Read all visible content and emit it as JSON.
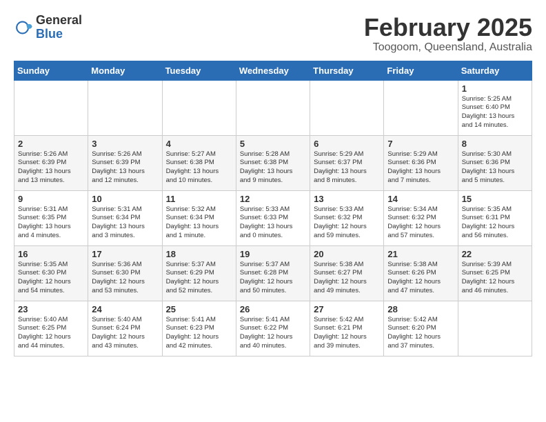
{
  "header": {
    "logo_general": "General",
    "logo_blue": "Blue",
    "month_title": "February 2025",
    "location": "Toogoom, Queensland, Australia"
  },
  "weekdays": [
    "Sunday",
    "Monday",
    "Tuesday",
    "Wednesday",
    "Thursday",
    "Friday",
    "Saturday"
  ],
  "weeks": [
    [
      {
        "day": "",
        "info": ""
      },
      {
        "day": "",
        "info": ""
      },
      {
        "day": "",
        "info": ""
      },
      {
        "day": "",
        "info": ""
      },
      {
        "day": "",
        "info": ""
      },
      {
        "day": "",
        "info": ""
      },
      {
        "day": "1",
        "info": "Sunrise: 5:25 AM\nSunset: 6:40 PM\nDaylight: 13 hours\nand 14 minutes."
      }
    ],
    [
      {
        "day": "2",
        "info": "Sunrise: 5:26 AM\nSunset: 6:39 PM\nDaylight: 13 hours\nand 13 minutes."
      },
      {
        "day": "3",
        "info": "Sunrise: 5:26 AM\nSunset: 6:39 PM\nDaylight: 13 hours\nand 12 minutes."
      },
      {
        "day": "4",
        "info": "Sunrise: 5:27 AM\nSunset: 6:38 PM\nDaylight: 13 hours\nand 10 minutes."
      },
      {
        "day": "5",
        "info": "Sunrise: 5:28 AM\nSunset: 6:38 PM\nDaylight: 13 hours\nand 9 minutes."
      },
      {
        "day": "6",
        "info": "Sunrise: 5:29 AM\nSunset: 6:37 PM\nDaylight: 13 hours\nand 8 minutes."
      },
      {
        "day": "7",
        "info": "Sunrise: 5:29 AM\nSunset: 6:36 PM\nDaylight: 13 hours\nand 7 minutes."
      },
      {
        "day": "8",
        "info": "Sunrise: 5:30 AM\nSunset: 6:36 PM\nDaylight: 13 hours\nand 5 minutes."
      }
    ],
    [
      {
        "day": "9",
        "info": "Sunrise: 5:31 AM\nSunset: 6:35 PM\nDaylight: 13 hours\nand 4 minutes."
      },
      {
        "day": "10",
        "info": "Sunrise: 5:31 AM\nSunset: 6:34 PM\nDaylight: 13 hours\nand 3 minutes."
      },
      {
        "day": "11",
        "info": "Sunrise: 5:32 AM\nSunset: 6:34 PM\nDaylight: 13 hours\nand 1 minute."
      },
      {
        "day": "12",
        "info": "Sunrise: 5:33 AM\nSunset: 6:33 PM\nDaylight: 13 hours\nand 0 minutes."
      },
      {
        "day": "13",
        "info": "Sunrise: 5:33 AM\nSunset: 6:32 PM\nDaylight: 12 hours\nand 59 minutes."
      },
      {
        "day": "14",
        "info": "Sunrise: 5:34 AM\nSunset: 6:32 PM\nDaylight: 12 hours\nand 57 minutes."
      },
      {
        "day": "15",
        "info": "Sunrise: 5:35 AM\nSunset: 6:31 PM\nDaylight: 12 hours\nand 56 minutes."
      }
    ],
    [
      {
        "day": "16",
        "info": "Sunrise: 5:35 AM\nSunset: 6:30 PM\nDaylight: 12 hours\nand 54 minutes."
      },
      {
        "day": "17",
        "info": "Sunrise: 5:36 AM\nSunset: 6:30 PM\nDaylight: 12 hours\nand 53 minutes."
      },
      {
        "day": "18",
        "info": "Sunrise: 5:37 AM\nSunset: 6:29 PM\nDaylight: 12 hours\nand 52 minutes."
      },
      {
        "day": "19",
        "info": "Sunrise: 5:37 AM\nSunset: 6:28 PM\nDaylight: 12 hours\nand 50 minutes."
      },
      {
        "day": "20",
        "info": "Sunrise: 5:38 AM\nSunset: 6:27 PM\nDaylight: 12 hours\nand 49 minutes."
      },
      {
        "day": "21",
        "info": "Sunrise: 5:38 AM\nSunset: 6:26 PM\nDaylight: 12 hours\nand 47 minutes."
      },
      {
        "day": "22",
        "info": "Sunrise: 5:39 AM\nSunset: 6:25 PM\nDaylight: 12 hours\nand 46 minutes."
      }
    ],
    [
      {
        "day": "23",
        "info": "Sunrise: 5:40 AM\nSunset: 6:25 PM\nDaylight: 12 hours\nand 44 minutes."
      },
      {
        "day": "24",
        "info": "Sunrise: 5:40 AM\nSunset: 6:24 PM\nDaylight: 12 hours\nand 43 minutes."
      },
      {
        "day": "25",
        "info": "Sunrise: 5:41 AM\nSunset: 6:23 PM\nDaylight: 12 hours\nand 42 minutes."
      },
      {
        "day": "26",
        "info": "Sunrise: 5:41 AM\nSunset: 6:22 PM\nDaylight: 12 hours\nand 40 minutes."
      },
      {
        "day": "27",
        "info": "Sunrise: 5:42 AM\nSunset: 6:21 PM\nDaylight: 12 hours\nand 39 minutes."
      },
      {
        "day": "28",
        "info": "Sunrise: 5:42 AM\nSunset: 6:20 PM\nDaylight: 12 hours\nand 37 minutes."
      },
      {
        "day": "",
        "info": ""
      }
    ]
  ]
}
